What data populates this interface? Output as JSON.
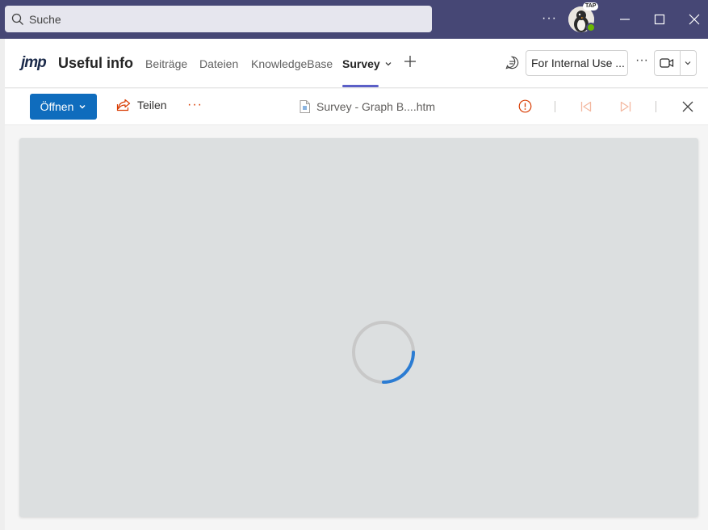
{
  "titlebar": {
    "search_placeholder": "Suche",
    "more_label": "···",
    "user_badge": "TAP",
    "presence_status": "available",
    "colors": {
      "bar": "#464775",
      "presence": "#6bb700"
    }
  },
  "channel": {
    "logo": "jmp",
    "title": "Useful info",
    "tabs": [
      {
        "label": "Beiträge"
      },
      {
        "label": "Dateien"
      },
      {
        "label": "KnowledgeBase"
      },
      {
        "label": "Survey",
        "active": true
      }
    ],
    "internal_use_label": "For Internal Use ...",
    "more_label": "···",
    "accent": "#5b5fc7"
  },
  "doc_toolbar": {
    "open_label": "Öffnen",
    "share_label": "Teilen",
    "more_label": "···",
    "file_name": "Survey - Graph B....htm",
    "icons": [
      "info-icon",
      "previous-icon",
      "next-icon",
      "close-icon"
    ],
    "accent": "#0f6cbd"
  },
  "content": {
    "state": "loading",
    "spinner_color": "#2b7cd3"
  }
}
